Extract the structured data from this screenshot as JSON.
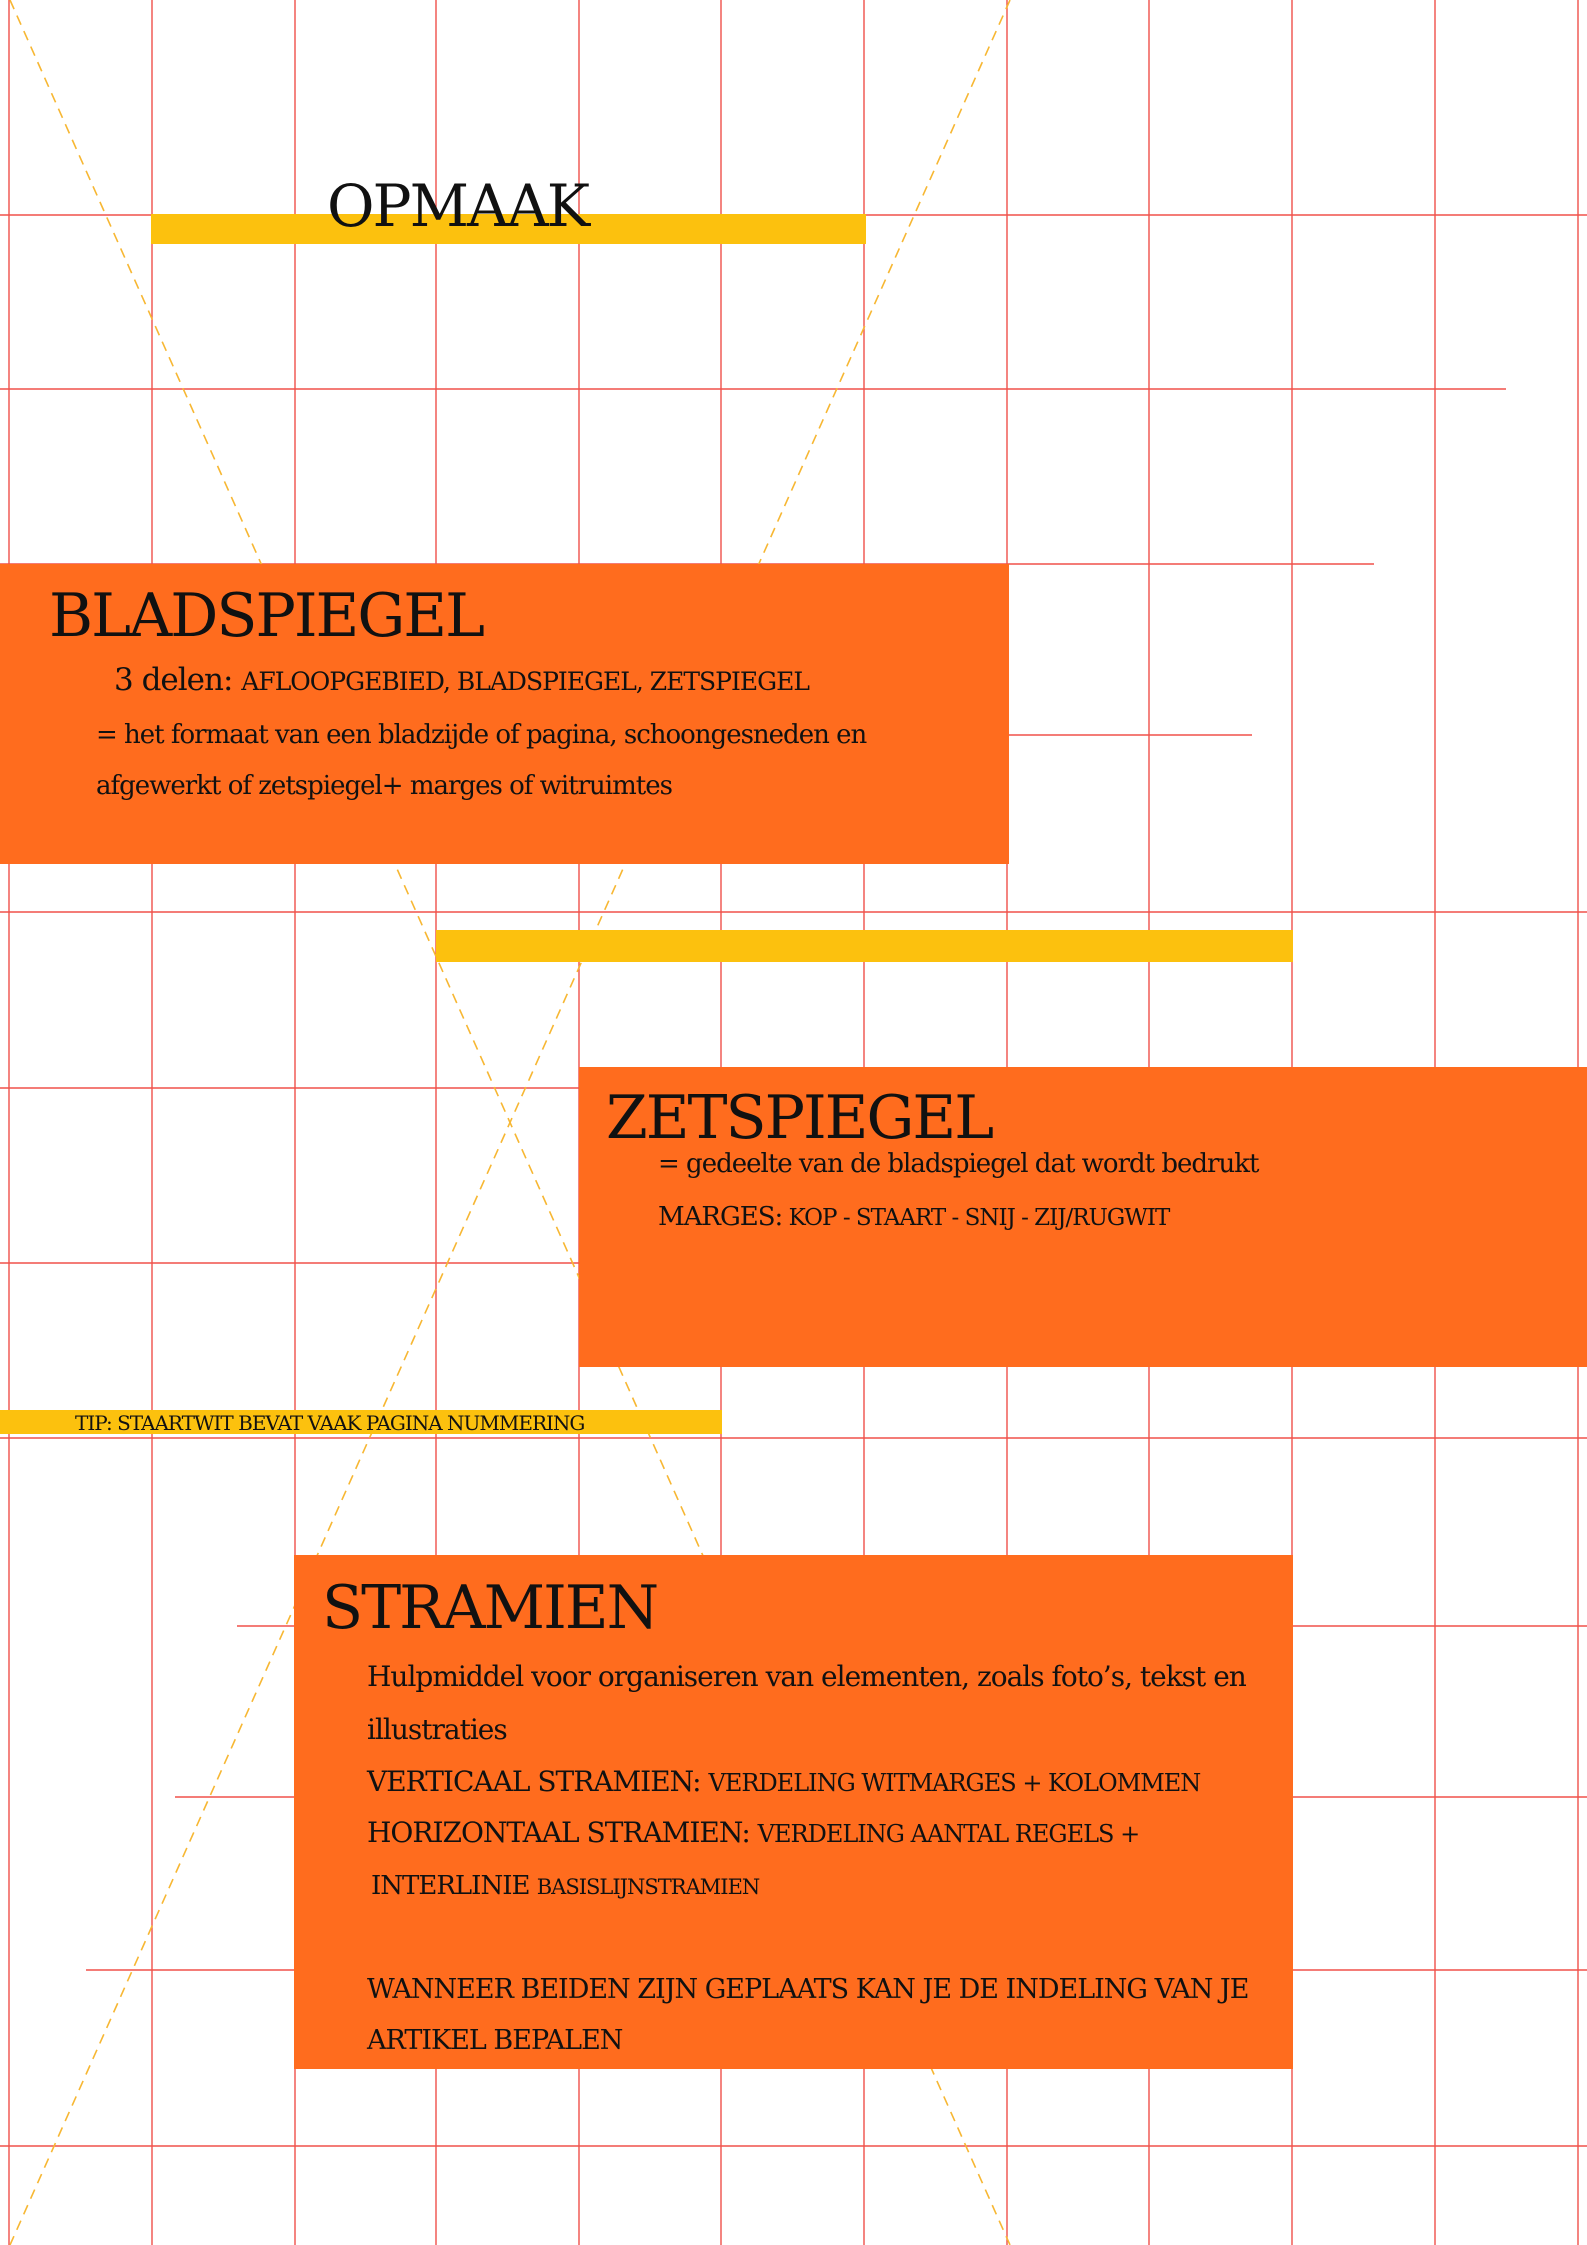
{
  "page": {
    "title": "OPMAAK",
    "colors": {
      "background": "#ffffff",
      "grid_line": "#f0514a",
      "diagonal": "#f7b733",
      "panel": "#ff6c1e",
      "highlight_bar": "#fcc10e",
      "text": "#111111"
    }
  },
  "bladspiegel": {
    "heading": "BLADSPIEGEL",
    "line1_lead": "3 delen: ",
    "line1_rest": "AFLOOPGEBIED, BLADSPIEGEL, ZETSPIEGEL",
    "line2": "= het formaat van een bladzijde of pagina, schoongesneden en",
    "line3": "afgewerkt of zetspiegel+ marges of witruimtes"
  },
  "zetspiegel": {
    "heading": "ZETSPIEGEL",
    "line1": "= gedeelte van de bladspiegel dat wordt bedrukt",
    "marges_label": "MARGES:",
    "marges_values": " KOP -  STAART - SNIJ - ZIJ/RUGWIT"
  },
  "tip": "TIP: STAARTWIT BEVAT VAAK PAGINA NUMMERING",
  "stramien": {
    "heading": "STRAMIEN",
    "line1": "Hulpmiddel voor organiseren van elementen, zoals foto’s, tekst en",
    "line2": "illustraties",
    "vertical_label": "VERTICAAL STRAMIEN: ",
    "vertical_text": "VERDELING WITMARGES + KOLOMMEN",
    "horizontal_label": "HORIZONTAAL STRAMIEN: ",
    "horizontal_text": "VERDELING AANTAL REGELS +",
    "interlinie_label": "INTERLINIE ",
    "interlinie_text": "BASISLIJNSTRAMIEN",
    "conclusion1": "WANNEER BEIDEN ZIJN GEPLAATS KAN JE DE INDELING VAN JE",
    "conclusion2": "ARTIKEL BEPALEN"
  }
}
